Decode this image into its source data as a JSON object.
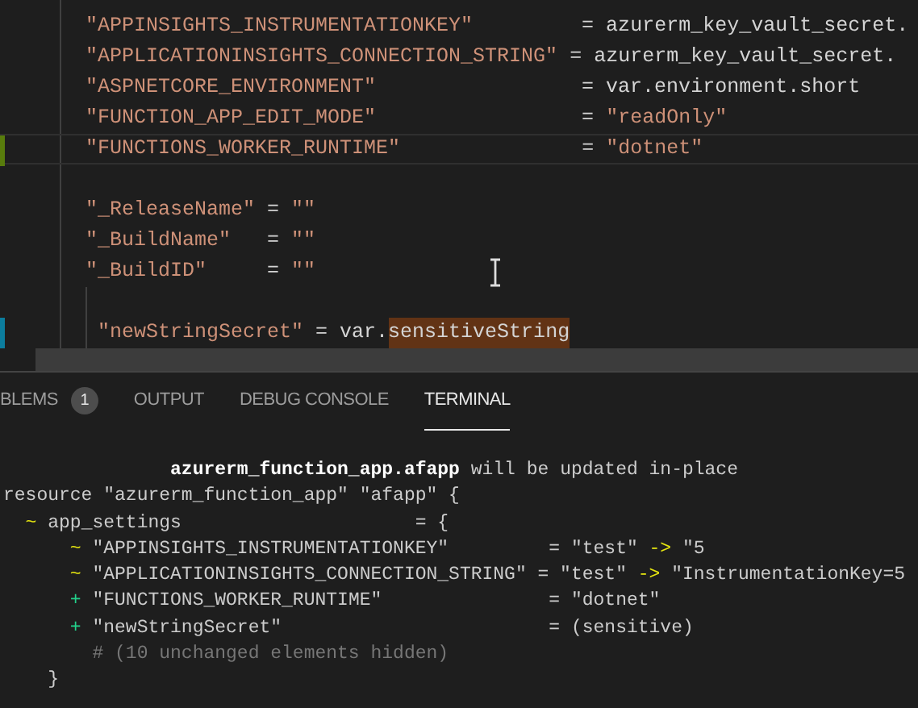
{
  "editor": {
    "lines": [
      {
        "kind": "code",
        "segments": [
          {
            "kind": "string",
            "text": "\"APPINSIGHTS_INSTRUMENTATIONKEY\""
          },
          {
            "kind": "plain",
            "text": "         = azurerm_key_vault_secret."
          }
        ]
      },
      {
        "kind": "code",
        "segments": [
          {
            "kind": "string",
            "text": "\"APPLICATIONINSIGHTS_CONNECTION_STRING\""
          },
          {
            "kind": "plain",
            "text": " = azurerm_key_vault_secret."
          }
        ]
      },
      {
        "kind": "code",
        "segments": [
          {
            "kind": "string",
            "text": "\"ASPNETCORE_ENVIRONMENT\""
          },
          {
            "kind": "plain",
            "text": "                 = var.environment.short"
          }
        ]
      },
      {
        "kind": "code",
        "segments": [
          {
            "kind": "string",
            "text": "\"FUNCTION_APP_EDIT_MODE\""
          },
          {
            "kind": "plain",
            "text": "                 = "
          },
          {
            "kind": "string",
            "text": "\"readOnly\""
          }
        ]
      },
      {
        "kind": "code",
        "added": true,
        "current": true,
        "segments": [
          {
            "kind": "string",
            "text": "\"FUNCTIONS_WORKER_RUNTIME\""
          },
          {
            "kind": "plain",
            "text": "               = "
          },
          {
            "kind": "string",
            "text": "\"dotnet\""
          }
        ]
      },
      {
        "kind": "blank"
      },
      {
        "kind": "code",
        "segments": [
          {
            "kind": "string",
            "text": "\"_ReleaseName\""
          },
          {
            "kind": "plain",
            "text": " = "
          },
          {
            "kind": "string",
            "text": "\"\""
          }
        ]
      },
      {
        "kind": "code",
        "segments": [
          {
            "kind": "string",
            "text": "\"_BuildName\""
          },
          {
            "kind": "plain",
            "text": "   = "
          },
          {
            "kind": "string",
            "text": "\"\""
          }
        ]
      },
      {
        "kind": "code",
        "segments": [
          {
            "kind": "string",
            "text": "\"_BuildID\""
          },
          {
            "kind": "plain",
            "text": "     = "
          },
          {
            "kind": "string",
            "text": "\"\""
          }
        ]
      },
      {
        "kind": "blank",
        "guide": true
      },
      {
        "kind": "code",
        "modified": true,
        "guide": true,
        "segments": [
          {
            "kind": "string",
            "text": " \"newStringSecret\""
          },
          {
            "kind": "plain",
            "text": " = var."
          },
          {
            "kind": "highlight",
            "text": "sensitiveString"
          }
        ]
      }
    ]
  },
  "panel": {
    "tabs": [
      {
        "label": "BLEMS",
        "badge": "1",
        "selected": false
      },
      {
        "label": "OUTPUT",
        "selected": false
      },
      {
        "label": "DEBUG CONSOLE",
        "selected": false
      },
      {
        "label": "TERMINAL",
        "selected": true
      }
    ],
    "terminal": [
      [
        {
          "kind": "bold",
          "text": "               azurerm_function_app.afapp"
        },
        {
          "kind": "plain",
          "text": " will be updated in-place"
        }
      ],
      [
        {
          "kind": "plain",
          "text": "resource \"azurerm_function_app\" \"afapp\" {"
        }
      ],
      [
        {
          "kind": "modified",
          "text": "  ~"
        },
        {
          "kind": "plain",
          "text": " app_settings                     = {"
        }
      ],
      [
        {
          "kind": "modified",
          "text": "      ~"
        },
        {
          "kind": "plain",
          "text": " \"APPINSIGHTS_INSTRUMENTATIONKEY\"         = \"test\" "
        },
        {
          "kind": "arrow",
          "text": "->"
        },
        {
          "kind": "plain",
          "text": " \"5"
        }
      ],
      [
        {
          "kind": "modified",
          "text": "      ~"
        },
        {
          "kind": "plain",
          "text": " \"APPLICATIONINSIGHTS_CONNECTION_STRING\" = \"test\" "
        },
        {
          "kind": "arrow",
          "text": "->"
        },
        {
          "kind": "plain",
          "text": " \"InstrumentationKey=5"
        }
      ],
      [
        {
          "kind": "added",
          "text": "      +"
        },
        {
          "kind": "plain",
          "text": " \"FUNCTIONS_WORKER_RUNTIME\"               = \"dotnet\""
        }
      ],
      [
        {
          "kind": "added",
          "text": "      +"
        },
        {
          "kind": "plain",
          "text": " \"newStringSecret\"                        = (sensitive)"
        }
      ],
      [
        {
          "kind": "comment",
          "text": "        # (10 unchanged elements hidden)"
        }
      ],
      [
        {
          "kind": "plain",
          "text": "    }"
        }
      ]
    ]
  }
}
